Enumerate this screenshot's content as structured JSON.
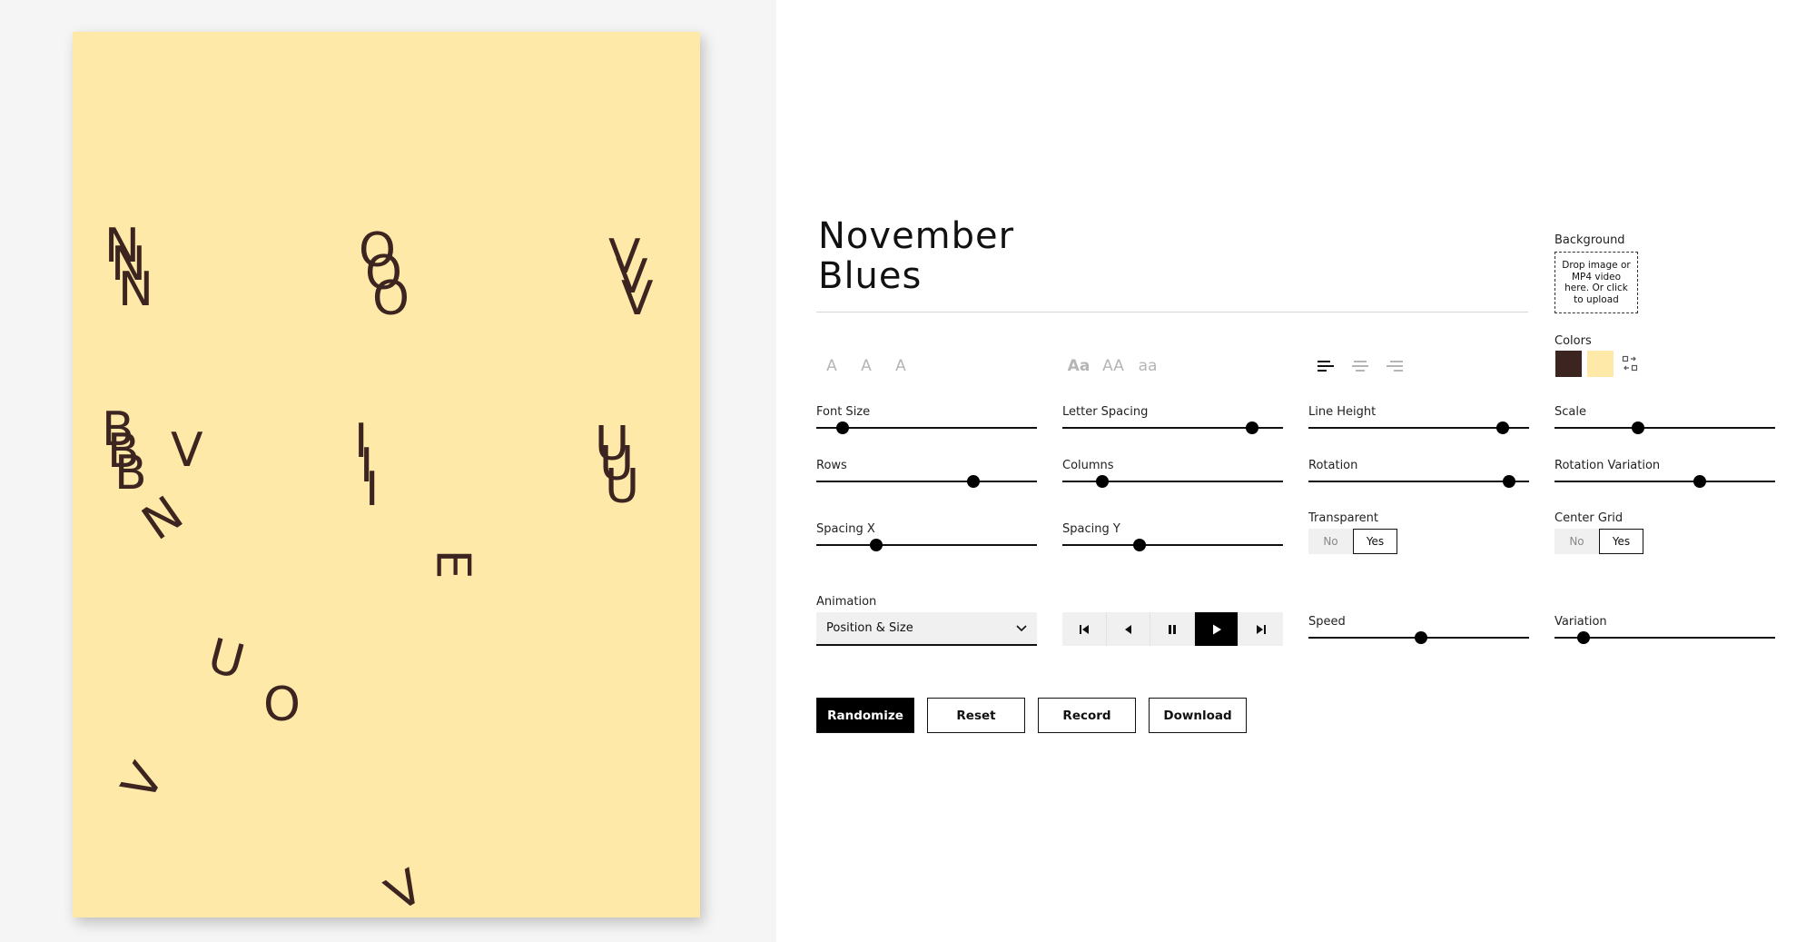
{
  "title": {
    "line1": "November",
    "line2": "Blues"
  },
  "poster": {
    "background_color": "#fee9a8",
    "text_color": "#3c2421",
    "glyphs": [
      "N",
      "N",
      "N",
      "O",
      "O",
      "O",
      "V",
      "V",
      "V",
      "B",
      "B",
      "B",
      "V",
      "N",
      "I",
      "I",
      "I",
      "U",
      "U",
      "U",
      "E",
      "U",
      "O",
      "V",
      "V"
    ]
  },
  "typography": {
    "font_weight_options": [
      "A",
      "A",
      "A"
    ],
    "font_weight_active": 0,
    "case_options": [
      "Aa",
      "AA",
      "aa"
    ],
    "case_active": 0,
    "align_options_icons": [
      "align-left-icon",
      "align-center-icon",
      "align-right-icon"
    ],
    "align_active": 0
  },
  "background": {
    "label": "Background",
    "drop_text": "Drop image or MP4 video here. Or click to upload"
  },
  "colors": {
    "label": "Colors",
    "swatches": [
      "#3c2421",
      "#fee9a8"
    ],
    "swap_icon": "swap-colors-icon"
  },
  "sliders": {
    "font_size": {
      "label": "Font Size",
      "value": 0.12
    },
    "letter_spacing": {
      "label": "Letter Spacing",
      "value": 0.86
    },
    "line_height": {
      "label": "Line Height",
      "value": 0.88
    },
    "scale": {
      "label": "Scale",
      "value": 0.38
    },
    "rows": {
      "label": "Rows",
      "value": 0.71
    },
    "columns": {
      "label": "Columns",
      "value": 0.18
    },
    "rotation": {
      "label": "Rotation",
      "value": 0.91
    },
    "rotation_variation": {
      "label": "Rotation Variation",
      "value": 0.66
    },
    "spacing_x": {
      "label": "Spacing X",
      "value": 0.27
    },
    "spacing_y": {
      "label": "Spacing Y",
      "value": 0.35
    },
    "speed": {
      "label": "Speed",
      "value": 0.51
    },
    "variation": {
      "label": "Variation",
      "value": 0.13
    }
  },
  "transparent": {
    "label": "Transparent",
    "no": "No",
    "yes": "Yes",
    "selected": "Yes"
  },
  "center_grid": {
    "label": "Center Grid",
    "no": "No",
    "yes": "Yes",
    "selected": "Yes"
  },
  "animation": {
    "label": "Animation",
    "selected": "Position & Size"
  },
  "transport": {
    "icons": [
      "skip-to-start-icon",
      "step-back-icon",
      "pause-icon",
      "play-icon",
      "skip-to-end-icon"
    ],
    "active": "play-icon"
  },
  "buttons": {
    "randomize": "Randomize",
    "reset": "Reset",
    "record": "Record",
    "download": "Download"
  }
}
